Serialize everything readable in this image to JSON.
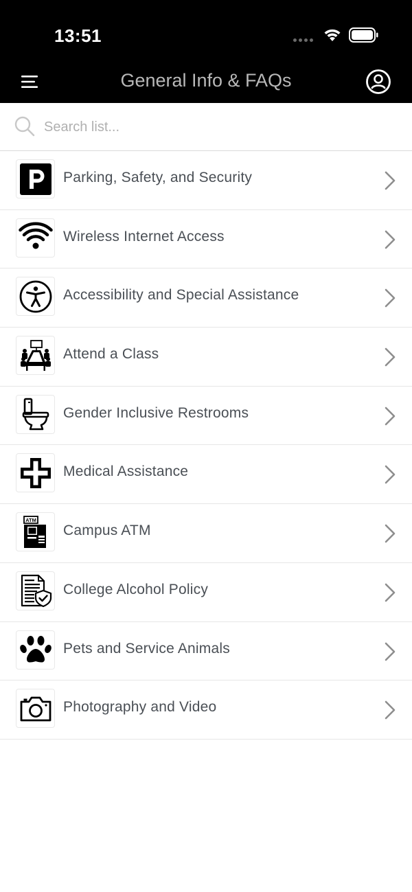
{
  "status": {
    "time": "13:51"
  },
  "nav": {
    "title": "General Info & FAQs"
  },
  "search": {
    "placeholder": "Search list..."
  },
  "items": [
    {
      "label": "Parking, Safety, and Security",
      "icon": "parking-icon"
    },
    {
      "label": "Wireless Internet Access",
      "icon": "wifi-icon"
    },
    {
      "label": "Accessibility and Special Assistance",
      "icon": "accessibility-icon"
    },
    {
      "label": "Attend a Class",
      "icon": "classroom-icon"
    },
    {
      "label": "Gender Inclusive Restrooms",
      "icon": "toilet-icon"
    },
    {
      "label": "Medical Assistance",
      "icon": "medical-cross-icon"
    },
    {
      "label": "Campus ATM",
      "icon": "atm-icon"
    },
    {
      "label": "College Alcohol Policy",
      "icon": "policy-document-icon"
    },
    {
      "label": "Pets and Service Animals",
      "icon": "paw-icon"
    },
    {
      "label": "Photography and Video",
      "icon": "camera-icon"
    }
  ],
  "atm_sign": "ATM",
  "colors": {
    "header_bg": "#000000",
    "title": "#b8b8b8",
    "label": "#4a4f55",
    "chevron": "#8e8e8e"
  }
}
